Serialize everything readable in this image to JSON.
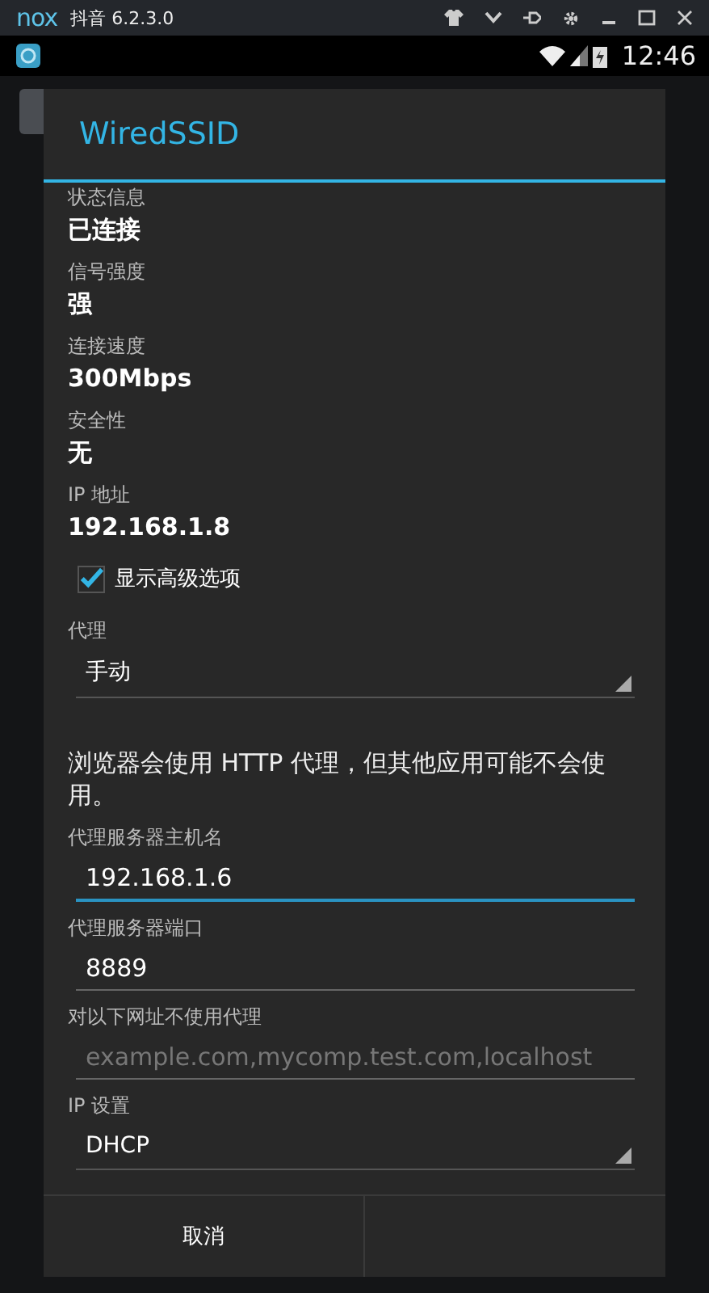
{
  "emulator": {
    "logo": "nox",
    "title": "抖音 6.2.3.0"
  },
  "status_bar": {
    "time": "12:46"
  },
  "dialog": {
    "title": "WiredSSID",
    "info": [
      {
        "label": "状态信息",
        "value": "已连接"
      },
      {
        "label": "信号强度",
        "value": "强"
      },
      {
        "label": "连接速度",
        "value": "300Mbps"
      },
      {
        "label": "安全性",
        "value": "无"
      },
      {
        "label": "IP 地址",
        "value": "192.168.1.8"
      }
    ],
    "advanced": {
      "label": "显示高级选项",
      "checked": true
    },
    "proxy": {
      "label": "代理",
      "value": "手动"
    },
    "note": "浏览器会使用 HTTP 代理，但其他应用可能不会使用。",
    "fields": [
      {
        "label": "代理服务器主机名",
        "value": "192.168.1.6",
        "focused": true
      },
      {
        "label": "代理服务器端口",
        "value": "8889",
        "focused": false
      },
      {
        "label": "对以下网址不使用代理",
        "placeholder": "example.com,mycomp.test.com,localhost",
        "focused": false
      }
    ],
    "ip_settings": {
      "label": "IP 设置",
      "value": "DHCP"
    },
    "buttons": [
      {
        "label": "取消"
      }
    ]
  }
}
